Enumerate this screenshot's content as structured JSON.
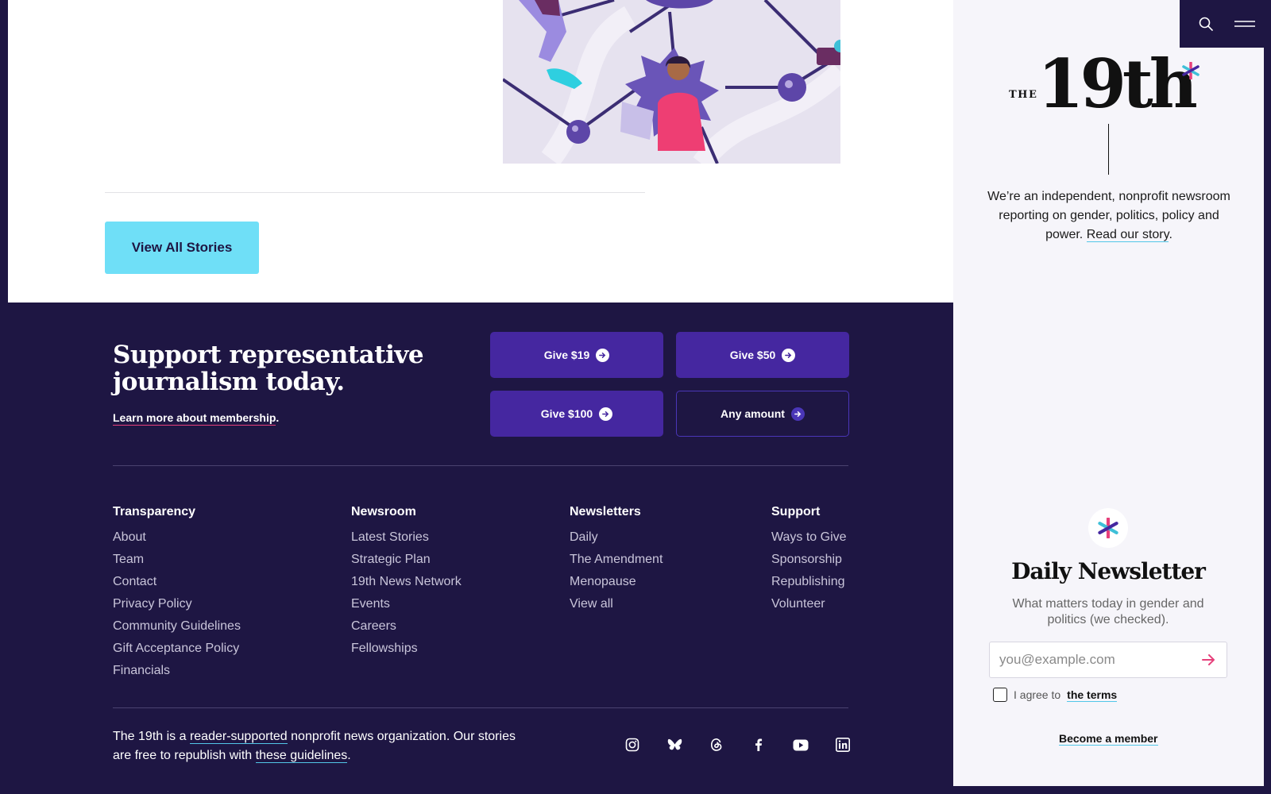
{
  "main": {
    "view_all_label": "View All Stories"
  },
  "support": {
    "title": "Support representative journalism today.",
    "link": "Learn more about membership",
    "link_suffix": ".",
    "buttons": [
      {
        "label": "Give $19"
      },
      {
        "label": "Give $50"
      },
      {
        "label": "Give $100"
      },
      {
        "label": "Any amount"
      }
    ]
  },
  "footer": {
    "columns": [
      {
        "title": "Transparency",
        "links": [
          "About",
          "Team",
          "Contact",
          "Privacy Policy",
          "Community Guidelines",
          "Gift Acceptance Policy",
          "Financials"
        ]
      },
      {
        "title": "Newsroom",
        "links": [
          "Latest Stories",
          "Strategic Plan",
          "19th News Network",
          "Events",
          "Careers",
          "Fellowships"
        ]
      },
      {
        "title": "Newsletters",
        "links": [
          "Daily",
          "The Amendment",
          "Menopause",
          "View all"
        ]
      },
      {
        "title": "Support",
        "links": [
          "Ways to Give",
          "Sponsorship",
          "Republishing",
          "Volunteer"
        ]
      }
    ],
    "about": {
      "t1": "The 19th is a ",
      "link1": "reader-supported",
      "t2": " nonprofit news organization. Our stories are free to republish with ",
      "link2": "these guidelines",
      "t3": "."
    },
    "socials": [
      "instagram-icon",
      "bluesky-icon",
      "threads-icon",
      "facebook-icon",
      "youtube-icon",
      "linkedin-icon"
    ]
  },
  "sidebar": {
    "logo_the": "THE",
    "logo_name": "19th",
    "tagline": "We’re an independent, nonprofit newsroom reporting on gender, politics, policy and power. ",
    "tagline_link": "Read our story",
    "tagline_suffix": ".",
    "newsletter": {
      "title": "Daily Newsletter",
      "description": "What matters today in gender and politics (we checked).",
      "placeholder": "you@example.com",
      "agree_text": "I agree to",
      "terms_link": "the terms",
      "member_link": "Become a member"
    }
  },
  "colors": {
    "footer_bg": "#1e1643",
    "button_purple": "#4527a0",
    "accent_cyan": "#6fdff7",
    "accent_pink": "#e6407b"
  }
}
